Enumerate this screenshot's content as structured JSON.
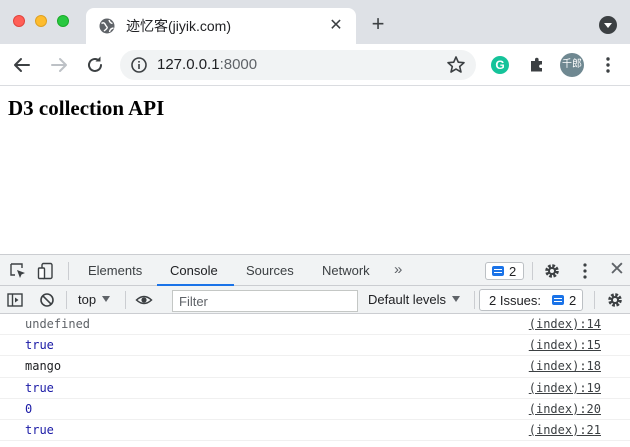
{
  "browser": {
    "tab_title": "迹忆客(jiyik.com)",
    "url_host": "127.0.0.1",
    "url_port": ":8000",
    "avatar_text": "千郎",
    "extension_letter": "G"
  },
  "page": {
    "heading": "D3 collection API"
  },
  "devtools": {
    "tabs": [
      {
        "label": "Elements"
      },
      {
        "label": "Console",
        "active": true
      },
      {
        "label": "Sources"
      },
      {
        "label": "Network"
      }
    ],
    "more_tabs": "»",
    "messages_count": "2",
    "console_bar": {
      "context": "top",
      "filter_placeholder": "Filter",
      "levels": "Default levels",
      "issues_label": "2 Issues:",
      "issues_count": "2"
    },
    "logs": [
      {
        "message": "undefined",
        "type": "undefined",
        "source": "(index):14"
      },
      {
        "message": "true",
        "type": "bool",
        "source": "(index):15"
      },
      {
        "message": "mango",
        "type": "string",
        "source": "(index):18"
      },
      {
        "message": "true",
        "type": "bool",
        "source": "(index):19"
      },
      {
        "message": "0",
        "type": "number",
        "source": "(index):20"
      },
      {
        "message": "true",
        "type": "bool",
        "source": "(index):21"
      }
    ]
  },
  "colors": {
    "accent": "#1a73e8",
    "value_blue": "#1a1aa6",
    "tabstrip": "#dee1e6"
  }
}
